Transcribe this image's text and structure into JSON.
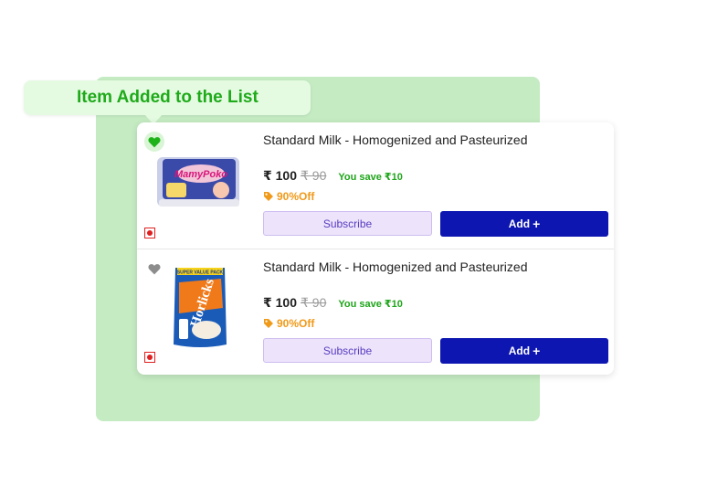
{
  "toast": {
    "message": "Item Added to the List"
  },
  "products": [
    {
      "title": "Standard Milk - Homogenized and Pasteurized",
      "price": "₹ 100",
      "mrp": "₹ 90",
      "savings": "You save ₹10",
      "discount": "90%Off",
      "subscribe_label": "Subscribe",
      "add_label": "Add",
      "add_icon": "+",
      "wishlisted": true,
      "image": "mamypoko-pants-pack"
    },
    {
      "title": "Standard Milk - Homogenized and Pasteurized",
      "price": "₹ 100",
      "mrp": "₹ 90",
      "savings": "You save ₹10",
      "discount": "90%Off",
      "subscribe_label": "Subscribe",
      "add_label": "Add",
      "add_icon": "+",
      "wishlisted": false,
      "image": "horlicks-pack"
    }
  ],
  "colors": {
    "accent_green": "#1faa1a",
    "add_button": "#0d16b0",
    "subscribe_bg": "#ede4fb",
    "discount": "#f09a1a",
    "veg_mark": "#e02020"
  }
}
